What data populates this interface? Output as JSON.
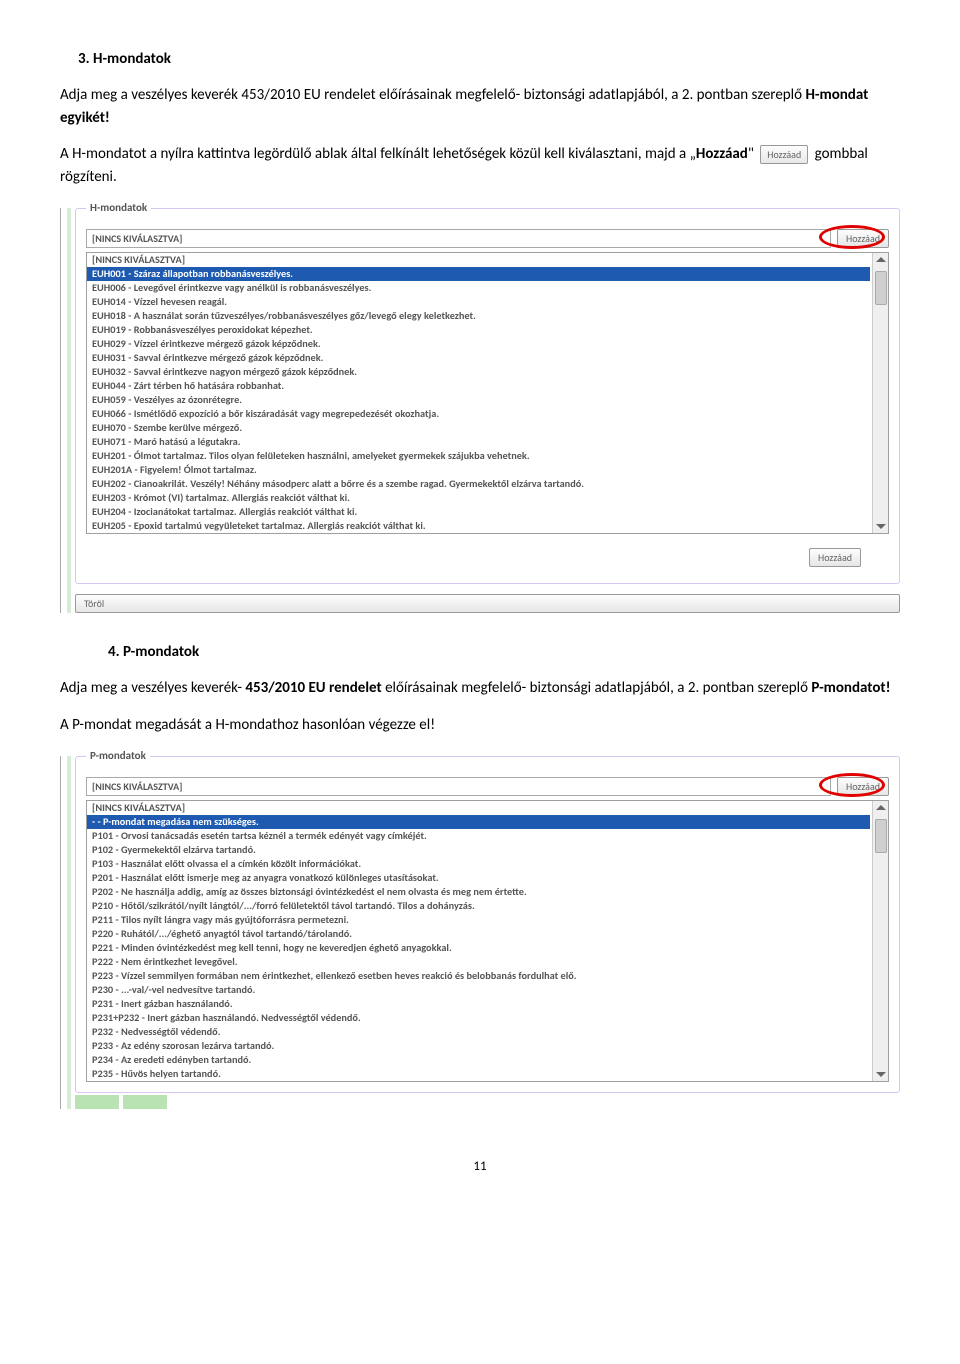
{
  "section3": {
    "heading": "3. H-mondatok",
    "p1a": "Adja meg a veszélyes keverék 453/2010 EU rendelet előírásainak megfelelő- biztonsági adatlapjából, a 2. pontban szereplő ",
    "p1bold": "H-mondat egyikét!",
    "p2a": "A H-mondatot a nyílra kattintva legördülő ablak által felkínált lehetőségek közül kell kiválasztani, majd a „",
    "p2b_bold": "Hozzáad",
    "p2b_rest": "\" ",
    "p2_inlinebtn": "Hozzáad",
    "p2c": " gombbal rögzíteni."
  },
  "screenshot1": {
    "legend": "H-mondatok",
    "selected_top": "[NINCS KIVÁLASZTVA]",
    "add_btn": "Hozzáad",
    "extra_btn": "Hozzáad",
    "torol_btn": "Töröl",
    "options": [
      "[NINCS KIVÁLASZTVA]",
      "EUH001 - Száraz állapotban robbanásveszélyes.",
      "EUH006 - Levegővel érintkezve vagy anélkül is robbanásveszélyes.",
      "EUH014 - Vízzel hevesen reagál.",
      "EUH018 - A használat során tűzveszélyes/robbanásveszélyes gőz/levegő elegy keletkezhet.",
      "EUH019 - Robbanásveszélyes peroxidokat képezhet.",
      "EUH029 - Vízzel érintkezve mérgező gázok képződnek.",
      "EUH031 - Savval érintkezve mérgező gázok képződnek.",
      "EUH032 - Savval érintkezve nagyon mérgező gázok képződnek.",
      "EUH044 - Zárt térben hő hatására robbanhat.",
      "EUH059 - Veszélyes az ózonrétegre.",
      "EUH066 - Ismétlődő expozíció a bőr kiszáradását vagy megrepedezését okozhatja.",
      "EUH070 - Szembe kerülve mérgező.",
      "EUH071 - Maró hatású a légutakra.",
      "EUH201 - Ólmot tartalmaz. Tilos olyan felületeken használni, amelyeket gyermekek szájukba vehetnek.",
      "EUH201A - Figyelem! Ólmot tartalmaz.",
      "EUH202 - Cianoakrilát. Veszély! Néhány másodperc alatt a bőrre és a szembe ragad. Gyermekektől elzárva tartandó.",
      "EUH203 - Krómot (VI) tartalmaz. Allergiás reakciót válthat ki.",
      "EUH204 - Izocianátokat tartalmaz. Allergiás reakciót válthat ki.",
      "EUH205 - Epoxid tartalmú vegyületeket tartalmaz. Allergiás reakciót válthat ki."
    ],
    "selected_index": 1
  },
  "section4": {
    "heading": "4. P-mondatok",
    "p1a": "Adja meg a veszélyes keverék- ",
    "p1b_bold": "453/2010 EU rendelet",
    "p1c": " előírásainak megfelelő- biztonsági adatlapjából, a 2. pontban szereplő ",
    "p1d_bold": "P-mondatot!",
    "p2": "A P-mondat megadását a H-mondathoz hasonlóan végezze el!"
  },
  "screenshot2": {
    "legend": "P-mondatok",
    "selected_top": "[NINCS KIVÁLASZTVA]",
    "add_btn": "Hozzáad",
    "options": [
      "[NINCS KIVÁLASZTVA]",
      "- - P-mondat megadása nem szükséges.",
      "P101 - Orvosi tanácsadás esetén tartsa kéznél a termék edényét vagy címkéjét.",
      "P102 - Gyermekektől elzárva tartandó.",
      "P103 - Használat előtt olvassa el a címkén közölt információkat.",
      "P201 - Használat előtt ismerje meg az anyagra vonatkozó különleges utasításokat.",
      "P202 - Ne használja addig, amíg az összes biztonsági óvintézkedést el nem olvasta és meg nem értette.",
      "P210 - Hőtől/szikrától/nyílt lángtól/.../forró felületektől távol tartandó. Tilos a dohányzás.",
      "P211 - Tilos nyílt lángra vagy más gyújtóforrásra permetezni.",
      "P220 - Ruhától/.../éghető anyagtól távol tartandó/tárolandó.",
      "P221 - Minden óvintézkedést meg kell tenni, hogy ne keveredjen éghető anyagokkal.",
      "P222 - Nem érintkezhet levegővel.",
      "P223 - Vízzel semmilyen formában nem érintkezhet, ellenkező esetben heves reakció és belobbanás fordulhat elő.",
      "P230 - ...-val/-vel nedvesítve tartandó.",
      "P231 - Inert gázban használandó.",
      "P231+P232 - Inert gázban használandó. Nedvességtől védendő.",
      "P232 - Nedvességtől védendő.",
      "P233 - Az edény szorosan lezárva tartandó.",
      "P234 - Az eredeti edényben tartandó.",
      "P235 - Hűvös helyen tartandó."
    ],
    "selected_index": 1
  },
  "page_number": "11"
}
